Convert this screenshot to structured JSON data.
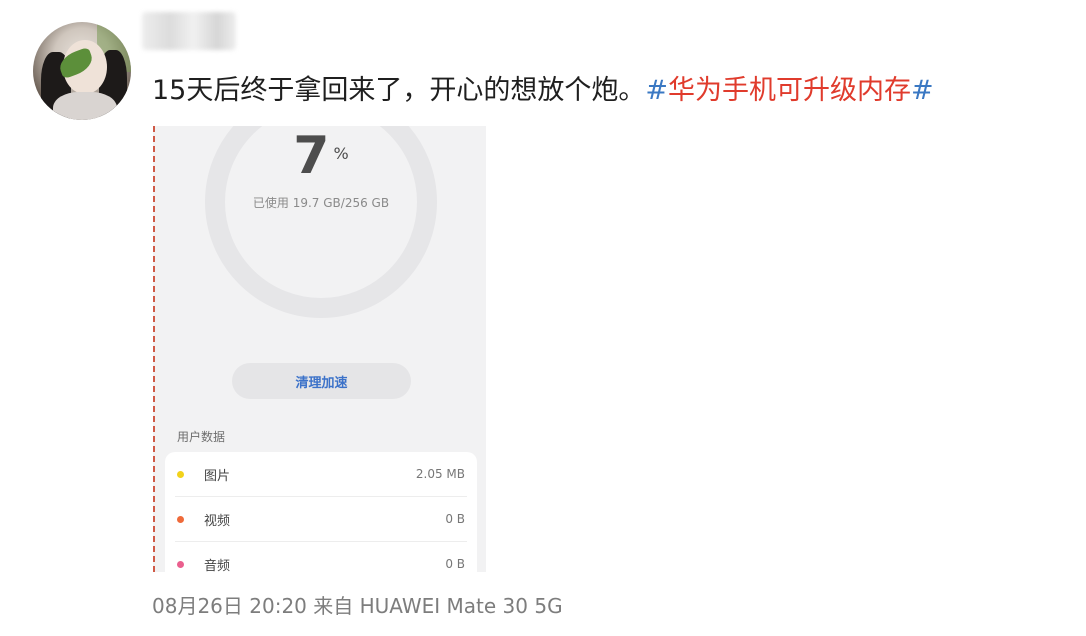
{
  "post": {
    "text_main": "15天后终于拿回来了，开心的想放个炮。",
    "hash_open": "#",
    "topic": "华为手机可升级内存",
    "hash_close": "#"
  },
  "screenshot": {
    "percent_value": "7",
    "percent_symbol": "%",
    "usage_text": "已使用 19.7 GB/256 GB",
    "clean_button_label": "清理加速",
    "section_title": "用户数据",
    "items": [
      {
        "label": "图片",
        "value": "2.05 MB",
        "dot_color": "#f2d21b"
      },
      {
        "label": "视频",
        "value": "0 B",
        "dot_color": "#ef6a3a"
      },
      {
        "label": "音频",
        "value": "0 B",
        "dot_color": "#ea5f8e"
      }
    ]
  },
  "footer": {
    "meta": "08月26日 20:20  来自 HUAWEI Mate 30 5G"
  }
}
